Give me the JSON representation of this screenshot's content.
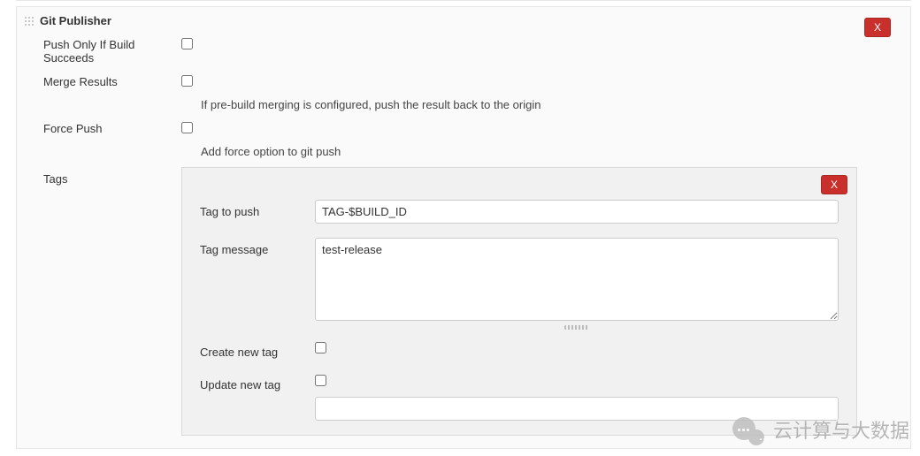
{
  "section": {
    "title": "Git Publisher",
    "closeLabel": "X"
  },
  "fields": {
    "pushOnly": {
      "label": "Push Only If Build Succeeds",
      "checked": false
    },
    "mergeResults": {
      "label": "Merge Results",
      "checked": false,
      "hint": "If pre-build merging is configured, push the result back to the origin"
    },
    "forcePush": {
      "label": "Force Push",
      "checked": false,
      "hint": "Add force option to git push"
    },
    "tags": {
      "label": "Tags"
    }
  },
  "tagsPanel": {
    "closeLabel": "X",
    "tagToPush": {
      "label": "Tag to push",
      "value": "TAG-$BUILD_ID"
    },
    "tagMessage": {
      "label": "Tag message",
      "value": "test-release"
    },
    "createNewTag": {
      "label": "Create new tag",
      "checked": false
    },
    "updateNewTag": {
      "label": "Update new tag",
      "checked": false
    }
  },
  "watermark": {
    "text": "云计算与大数据"
  }
}
